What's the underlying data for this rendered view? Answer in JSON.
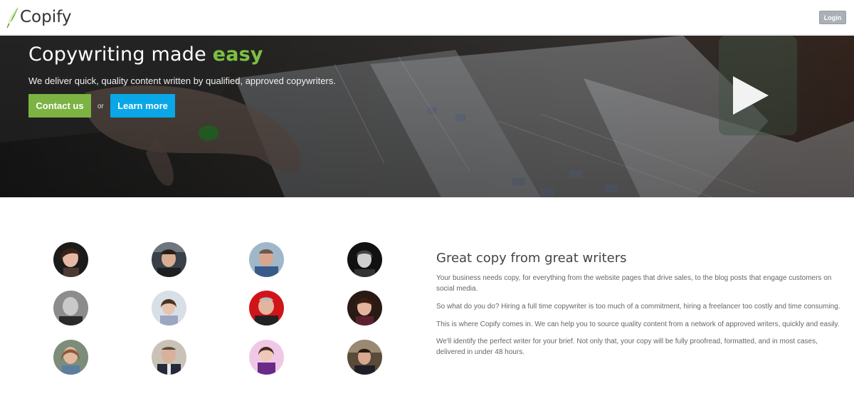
{
  "header": {
    "logo_text": "Copify",
    "login_label": "Login"
  },
  "hero": {
    "title_main": "Copywriting made ",
    "title_accent": "easy",
    "subtitle": "We deliver quick, quality content written by qualified, approved copywriters.",
    "contact_label": "Contact us",
    "or_label": "or",
    "learn_label": "Learn more",
    "play_icon": "play-icon"
  },
  "writers": {
    "count": 12
  },
  "section": {
    "title": "Great copy from great writers",
    "paragraphs": [
      "Your business needs copy, for everything from the website pages that drive sales, to the blog posts that engage customers on social media.",
      "So what do you do? Hiring a full time copywriter is too much of a commitment, hiring a freelancer too costly and time consuming.",
      "This is where Copify comes in. We can help you to source quality content from a network of approved writers, quickly and easily.",
      "We'll identify the perfect writer for your brief. Not only that, your copy will be fully proofread, formatted, and in most cases, delivered in under 48 hours."
    ]
  },
  "colors": {
    "brand_green": "#7cb342",
    "accent_blue": "#0aa7e8",
    "login_gray": "#a9b0b7"
  }
}
